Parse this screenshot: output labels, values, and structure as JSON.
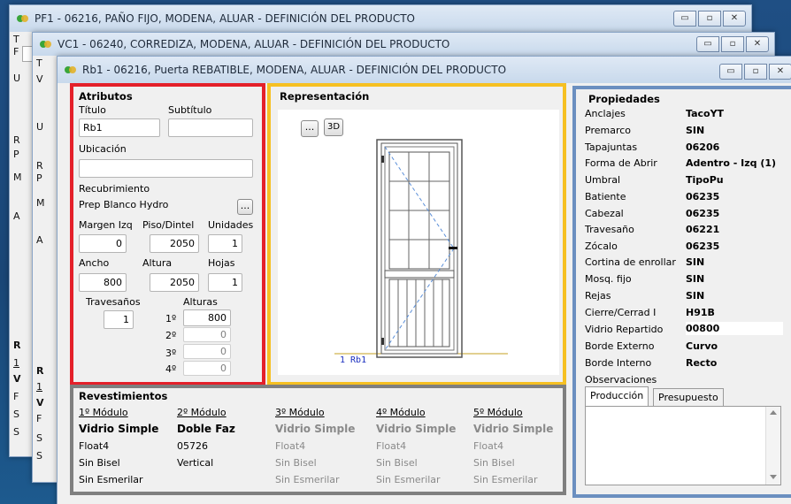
{
  "windows": {
    "pf1": {
      "title": "PF1  -  06216, PAÑO FIJO, MODENA, ALUAR   -   DEFINICIÓN DEL PRODUCTO"
    },
    "vc1": {
      "title": "VC1  -  06240, CORREDIZA, MODENA, ALUAR   -   DEFINICIÓN DEL PRODUCTO"
    },
    "rb1": {
      "title": "Rb1  -  06216, Puerta REBATIBLE, MODENA, ALUAR   -   DEFINICIÓN DEL PRODUCTO"
    }
  },
  "window_controls": {
    "minimize": "▭",
    "restore": "▫",
    "close": "✕"
  },
  "atributos": {
    "heading": "Atributos",
    "titulo_label": "Título",
    "titulo_value": "Rb1",
    "subtitulo_label": "Subtítulo",
    "subtitulo_value": "",
    "ubicacion_label": "Ubicación",
    "ubicacion_value": "",
    "recubrimiento_label": "Recubrimiento",
    "recubrimiento_value": "Prep Blanco Hydro",
    "ellipsis": "...",
    "margen_izq_label": "Margen Izq",
    "margen_izq_value": "0",
    "piso_dintel_label": "Piso/Dintel",
    "piso_dintel_value": "2050",
    "unidades_label": "Unidades",
    "unidades_value": "1",
    "ancho_label": "Ancho",
    "ancho_value": "800",
    "altura_label": "Altura",
    "altura_value": "2050",
    "hojas_label": "Hojas",
    "hojas_value": "1",
    "travesanos_label": "Travesaños",
    "travesanos_value": "1",
    "alturas_label": "Alturas",
    "alturas": [
      {
        "ord": "1º",
        "value": "800"
      },
      {
        "ord": "2º",
        "value": "0"
      },
      {
        "ord": "3º",
        "value": "0"
      },
      {
        "ord": "4º",
        "value": "0"
      }
    ]
  },
  "representacion": {
    "heading": "Representación",
    "btn_more": "...",
    "btn_3d": "3D",
    "caption": "1 Rb1"
  },
  "propiedades": {
    "heading": "Propiedades",
    "rows": [
      {
        "label": "Anclajes",
        "value": "TacoYT"
      },
      {
        "label": "Premarco",
        "value": "SIN"
      },
      {
        "label": "Tapajuntas",
        "value": "06206"
      },
      {
        "label": "Forma de Abrir",
        "value": "Adentro - Izq (1)"
      },
      {
        "label": "Umbral",
        "value": "TipoPu"
      },
      {
        "label": "Batiente",
        "value": "06235"
      },
      {
        "label": "Cabezal",
        "value": "06235"
      },
      {
        "label": "Travesaño",
        "value": "06221"
      },
      {
        "label": "Zócalo",
        "value": "06235"
      },
      {
        "label": "Cortina de enrollar",
        "value": "SIN"
      },
      {
        "label": "Mosq. fijo",
        "value": "SIN"
      },
      {
        "label": "Rejas",
        "value": "SIN"
      },
      {
        "label": "Cierre/Cerrad I",
        "value": "H91B"
      },
      {
        "label": "Vidrio Repartido",
        "value": "00800"
      },
      {
        "label": "Borde Externo",
        "value": "Curvo"
      },
      {
        "label": "Borde Interno",
        "value": "Recto"
      }
    ],
    "observaciones_label": "Observaciones",
    "tabs": [
      "Producción",
      "Presupuesto"
    ]
  },
  "revestimientos": {
    "heading": "Revestimientos",
    "modules": [
      {
        "title": "1º Módulo",
        "type": "Vidrio Simple",
        "glass": "Float4",
        "bisel": "Sin Bisel",
        "esmerilar": "Sin Esmerilar",
        "active": true
      },
      {
        "title": "2º Módulo",
        "type": "Doble Faz",
        "glass": "05726",
        "bisel": "Vertical",
        "esmerilar": "",
        "active": true
      },
      {
        "title": "3º Módulo",
        "type": "Vidrio Simple",
        "glass": "Float4",
        "bisel": "Sin Bisel",
        "esmerilar": "Sin Esmerilar",
        "active": false
      },
      {
        "title": "4º Módulo",
        "type": "Vidrio Simple",
        "glass": "Float4",
        "bisel": "Sin Bisel",
        "esmerilar": "Sin Esmerilar",
        "active": false
      },
      {
        "title": "5º Módulo",
        "type": "Vidrio Simple",
        "glass": "Float4",
        "bisel": "Sin Bisel",
        "esmerilar": "Sin Esmerilar",
        "active": false
      }
    ]
  },
  "background_fragments": {
    "pf1_letters": [
      "T",
      "F",
      "U",
      "R",
      "P",
      "M",
      "A",
      "R",
      "1",
      "V",
      "F",
      "S",
      "S"
    ],
    "vc1_letters": [
      "T",
      "V",
      "U",
      "R",
      "P",
      "M",
      "A",
      "R",
      "1",
      "V",
      "F",
      "S",
      "S"
    ]
  },
  "colors": {
    "atributos_border": "#e4202a",
    "representacion_border": "#f6c022",
    "propiedades_border": "#6b8fc0",
    "revestimientos_border": "#7f7f7f"
  }
}
